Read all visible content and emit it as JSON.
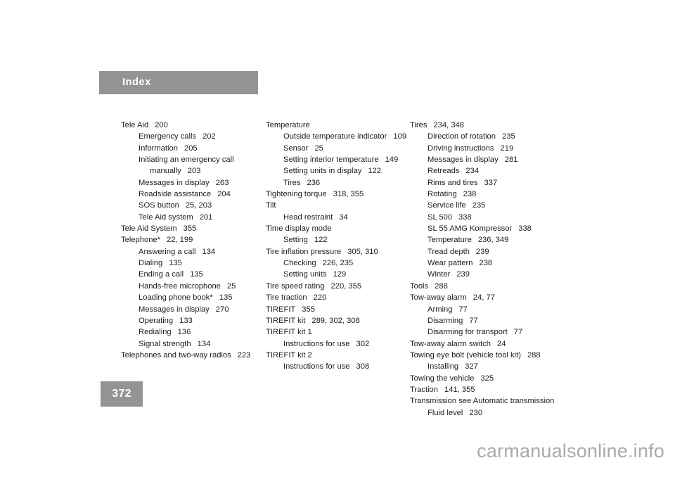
{
  "document": {
    "header_label": "Index",
    "page_number": "372",
    "watermark": "carmanualsonline.info",
    "accent_gray": "#949494",
    "text_color": "#1d1d1d",
    "watermark_color": "#a9a9a9"
  },
  "columns": [
    {
      "id": "column-1",
      "entries": [
        {
          "level": 0,
          "term": "Tele Aid",
          "pages": "200"
        },
        {
          "level": 1,
          "term": "Emergency calls",
          "pages": "202"
        },
        {
          "level": 1,
          "term": "Information",
          "pages": "205"
        },
        {
          "level": 1,
          "term": "Initiating an emergency call",
          "pages": ""
        },
        {
          "level": 2,
          "term": "manually",
          "pages": "203"
        },
        {
          "level": 1,
          "term": "Messages in display",
          "pages": "263"
        },
        {
          "level": 1,
          "term": "Roadside assistance",
          "pages": "204"
        },
        {
          "level": 1,
          "term": "SOS button",
          "pages": "25, 203"
        },
        {
          "level": 1,
          "term": "Tele Aid system",
          "pages": "201"
        },
        {
          "level": 0,
          "term": "Tele Aid System",
          "pages": "355"
        },
        {
          "level": 0,
          "term": "Telephone*",
          "pages": "22, 199"
        },
        {
          "level": 1,
          "term": "Answering a call",
          "pages": "134"
        },
        {
          "level": 1,
          "term": "Dialing",
          "pages": "135"
        },
        {
          "level": 1,
          "term": "Ending a call",
          "pages": "135"
        },
        {
          "level": 1,
          "term": "Hands-free microphone",
          "pages": "25"
        },
        {
          "level": 1,
          "term": "Loading phone book*",
          "pages": "135"
        },
        {
          "level": 1,
          "term": "Messages in display",
          "pages": "270"
        },
        {
          "level": 1,
          "term": "Operating",
          "pages": "133"
        },
        {
          "level": 1,
          "term": "Redialing",
          "pages": "136"
        },
        {
          "level": 1,
          "term": "Signal strength",
          "pages": "134"
        },
        {
          "level": 0,
          "term": "Telephones and two-way radios",
          "pages": "223"
        }
      ]
    },
    {
      "id": "column-2",
      "entries": [
        {
          "level": 0,
          "term": "Temperature",
          "pages": ""
        },
        {
          "level": 1,
          "term": "Outside temperature indicator",
          "pages": "109"
        },
        {
          "level": 1,
          "term": "Sensor",
          "pages": "25"
        },
        {
          "level": 1,
          "term": "Setting interior temperature",
          "pages": "149"
        },
        {
          "level": 1,
          "term": "Setting units in display",
          "pages": "122"
        },
        {
          "level": 1,
          "term": "Tires",
          "pages": "236"
        },
        {
          "level": 0,
          "term": "Tightening torque",
          "pages": "318, 355"
        },
        {
          "level": 0,
          "term": "Tilt",
          "pages": ""
        },
        {
          "level": 1,
          "term": "Head restraint",
          "pages": "34"
        },
        {
          "level": 0,
          "term": "Time display mode",
          "pages": ""
        },
        {
          "level": 1,
          "term": "Setting",
          "pages": "122"
        },
        {
          "level": 0,
          "term": "Tire inflation pressure",
          "pages": "305, 310"
        },
        {
          "level": 1,
          "term": "Checking",
          "pages": "226, 235"
        },
        {
          "level": 1,
          "term": "Setting units",
          "pages": "129"
        },
        {
          "level": 0,
          "term": "Tire speed rating",
          "pages": "220, 355"
        },
        {
          "level": 0,
          "term": "Tire traction",
          "pages": "220"
        },
        {
          "level": 0,
          "term": "TIREFIT",
          "pages": "355"
        },
        {
          "level": 0,
          "term": "TIREFIT kit",
          "pages": "289, 302, 308"
        },
        {
          "level": 0,
          "term": "TIREFIT kit 1",
          "pages": ""
        },
        {
          "level": 1,
          "term": "Instructions for use",
          "pages": "302"
        },
        {
          "level": 0,
          "term": "TIREFIT kit 2",
          "pages": ""
        },
        {
          "level": 1,
          "term": "Instructions for use",
          "pages": "308"
        }
      ]
    },
    {
      "id": "column-3",
      "entries": [
        {
          "level": 0,
          "term": "Tires",
          "pages": "234, 348"
        },
        {
          "level": 1,
          "term": "Direction of rotation",
          "pages": "235"
        },
        {
          "level": 1,
          "term": "Driving instructions",
          "pages": "219"
        },
        {
          "level": 1,
          "term": "Messages in display",
          "pages": "281"
        },
        {
          "level": 1,
          "term": "Retreads",
          "pages": "234"
        },
        {
          "level": 1,
          "term": "Rims and tires",
          "pages": "337"
        },
        {
          "level": 1,
          "term": "Rotating",
          "pages": "238"
        },
        {
          "level": 1,
          "term": "Service life",
          "pages": "235"
        },
        {
          "level": 1,
          "term": "SL 500",
          "pages": "338"
        },
        {
          "level": 1,
          "term": "SL 55 AMG Kompressor",
          "pages": "338"
        },
        {
          "level": 1,
          "term": "Temperature",
          "pages": "236, 349"
        },
        {
          "level": 1,
          "term": "Tread depth",
          "pages": "239"
        },
        {
          "level": 1,
          "term": "Wear pattern",
          "pages": "238"
        },
        {
          "level": 1,
          "term": "Winter",
          "pages": "239"
        },
        {
          "level": 0,
          "term": "Tools",
          "pages": "288"
        },
        {
          "level": 0,
          "term": "Tow-away alarm",
          "pages": "24, 77"
        },
        {
          "level": 1,
          "term": "Arming",
          "pages": "77"
        },
        {
          "level": 1,
          "term": "Disarming",
          "pages": "77"
        },
        {
          "level": 1,
          "term": "Disarming for transport",
          "pages": "77"
        },
        {
          "level": 0,
          "term": "Tow-away alarm switch",
          "pages": "24"
        },
        {
          "level": 0,
          "term": "Towing eye bolt (vehicle tool kit)",
          "pages": "288"
        },
        {
          "level": 1,
          "term": "Installing",
          "pages": "327"
        },
        {
          "level": 0,
          "term": "Towing the vehicle",
          "pages": "325"
        },
        {
          "level": 0,
          "term": "Traction",
          "pages": "141, 355"
        },
        {
          "level": 0,
          "term": "Transmission see Automatic transmission",
          "pages": ""
        },
        {
          "level": 1,
          "term": "Fluid level",
          "pages": "230"
        }
      ]
    }
  ]
}
